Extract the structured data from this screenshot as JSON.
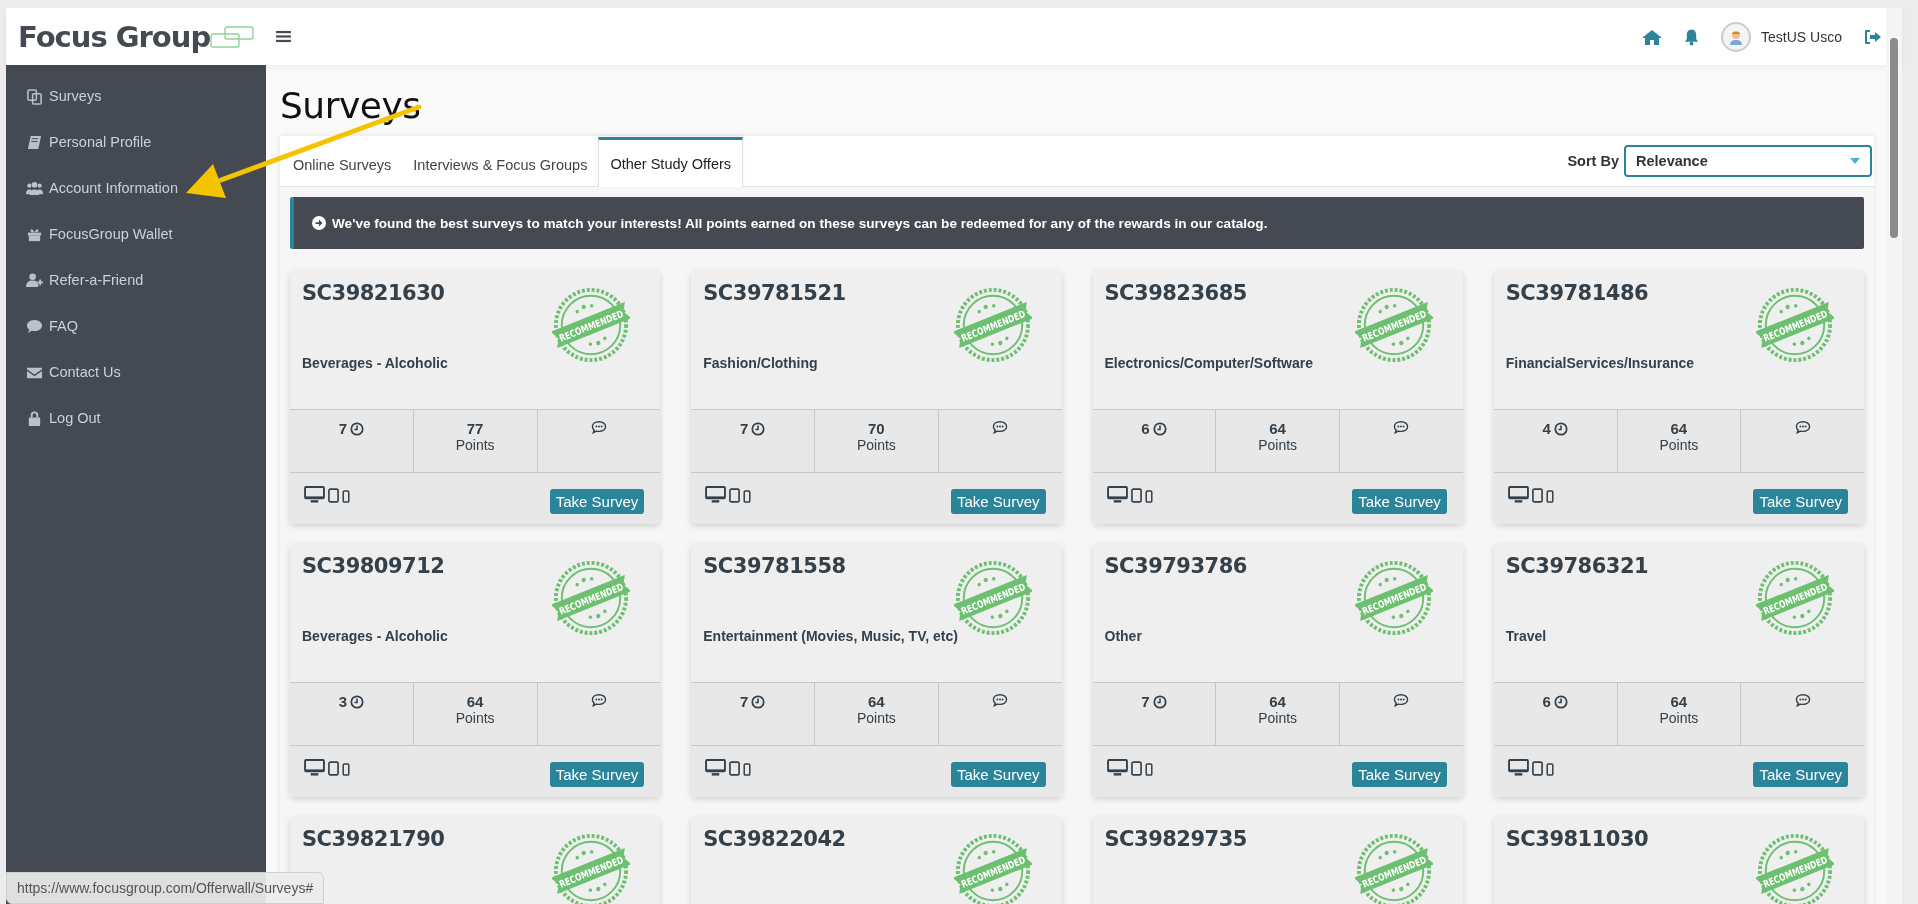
{
  "header": {
    "logo": "Focus Group",
    "user_name": "TestUS Usco"
  },
  "sidebar": {
    "items": [
      {
        "label": "Surveys",
        "kind": "surveys"
      },
      {
        "label": "Personal Profile",
        "kind": "profile"
      },
      {
        "label": "Account Information",
        "kind": "account"
      },
      {
        "label": "FocusGroup Wallet",
        "kind": "wallet"
      },
      {
        "label": "Refer-a-Friend",
        "kind": "refer"
      },
      {
        "label": "FAQ",
        "kind": "faq"
      },
      {
        "label": "Contact Us",
        "kind": "contact"
      },
      {
        "label": "Log Out",
        "kind": "logout"
      }
    ]
  },
  "page_title": "Surveys",
  "tabs": [
    {
      "label": "Online Surveys",
      "selected": false
    },
    {
      "label": "Interviews & Focus Groups",
      "selected": false
    },
    {
      "label": "Other Study Offers",
      "selected": true
    }
  ],
  "sort": {
    "label": "Sort By",
    "value": "Relevance"
  },
  "banner": "We've found the best surveys to match your interests! All points earned on these surveys can be redeemed for any of the rewards in our catalog.",
  "cards": [
    {
      "id": "SC39821630",
      "stamp": "RECOMMENDED",
      "category": "Beverages - Alcoholic",
      "minutes": "7",
      "points": "77",
      "points_label": "Points",
      "button": "Take Survey"
    },
    {
      "id": "SC39781521",
      "stamp": "RECOMMENDED",
      "category": "Fashion/Clothing",
      "minutes": "7",
      "points": "70",
      "points_label": "Points",
      "button": "Take Survey"
    },
    {
      "id": "SC39823685",
      "stamp": "RECOMMENDED",
      "category": "Electronics/Computer/Software",
      "minutes": "6",
      "points": "64",
      "points_label": "Points",
      "button": "Take Survey"
    },
    {
      "id": "SC39781486",
      "stamp": "RECOMMENDED",
      "category": "FinancialServices/Insurance",
      "minutes": "4",
      "points": "64",
      "points_label": "Points",
      "button": "Take Survey"
    },
    {
      "id": "SC39809712",
      "stamp": "RECOMMENDED",
      "category": "Beverages - Alcoholic",
      "minutes": "3",
      "points": "64",
      "points_label": "Points",
      "button": "Take Survey"
    },
    {
      "id": "SC39781558",
      "stamp": "RECOMMENDED",
      "category": "Entertainment (Movies, Music, TV, etc)",
      "minutes": "7",
      "points": "64",
      "points_label": "Points",
      "button": "Take Survey"
    },
    {
      "id": "SC39793786",
      "stamp": "RECOMMENDED",
      "category": "Other",
      "minutes": "7",
      "points": "64",
      "points_label": "Points",
      "button": "Take Survey"
    },
    {
      "id": "SC39786321",
      "stamp": "RECOMMENDED",
      "category": "Travel",
      "minutes": "6",
      "points": "64",
      "points_label": "Points",
      "button": "Take Survey"
    },
    {
      "id": "SC39821790",
      "stamp": "RECOMMENDED"
    },
    {
      "id": "SC39822042",
      "stamp": "RECOMMENDED"
    },
    {
      "id": "SC39829735",
      "stamp": "RECOMMENDED"
    },
    {
      "id": "SC39811030",
      "stamp": "RECOMMENDED"
    }
  ],
  "status_url": "https://www.focusgroup.com/Offerwall/Surveys#"
}
